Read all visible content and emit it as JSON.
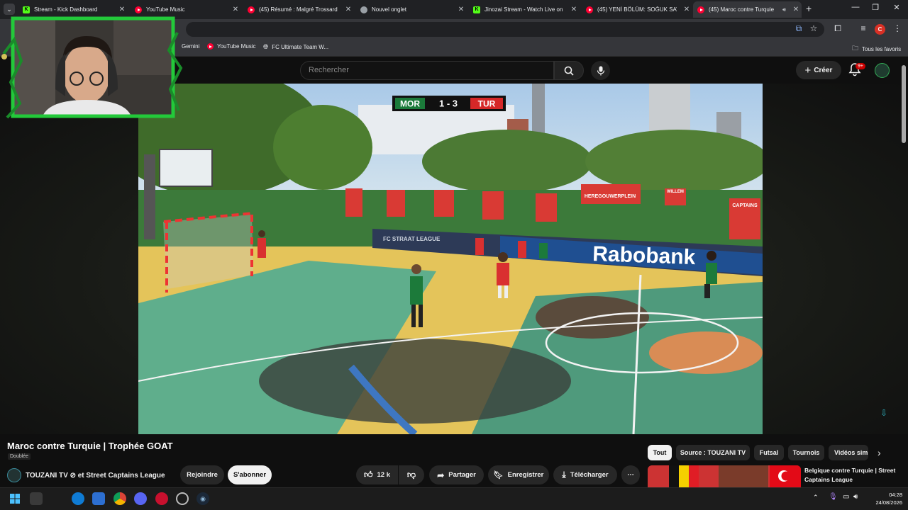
{
  "tabs": [
    {
      "title": "Stream - Kick Dashboard",
      "favicon": "kick-icon",
      "active": false
    },
    {
      "title": "YouTube Music",
      "favicon": "youtube-icon",
      "active": false
    },
    {
      "title": "(45) Résumé : Malgré Trossard",
      "favicon": "youtube-icon",
      "active": false
    },
    {
      "title": "Nouvel onglet",
      "favicon": "chrome-icon",
      "active": false
    },
    {
      "title": "Jinozai Stream - Watch Live on",
      "favicon": "kick-icon",
      "active": false
    },
    {
      "title": "(45) YENİ BÖLÜM: SOĞUK SAV",
      "favicon": "youtube-icon",
      "active": false
    },
    {
      "title": "(45) Maroc contre Turquie",
      "favicon": "youtube-icon",
      "active": true
    }
  ],
  "bookmarks": [
    {
      "label": "Gemini",
      "icon": "gemini-icon"
    },
    {
      "label": "YouTube Music",
      "icon": "youtube-music-icon"
    },
    {
      "label": "FC Ultimate Team W...",
      "icon": "globe-icon"
    }
  ],
  "all_bookmarks_label": "Tous les favoris",
  "profile_initial": "C",
  "youtube": {
    "search_placeholder": "Rechercher",
    "create_label": "Créer",
    "notif_badge": "9+"
  },
  "video": {
    "scoreboard": {
      "home": "MOR",
      "score": "1 - 3",
      "away": "TUR"
    },
    "banners": [
      "Rabobank",
      "FC STRAAT LEAGUE",
      "CAPTAINS",
      "HEREGOUWERPLEIN",
      "WILLEM"
    ],
    "title": "Maroc contre Turquie | Trophée GOAT",
    "dubbed_label": "Doublée",
    "channel_name": "TOUZANI TV ⊘ et Street Captains League",
    "join_label": "Rejoindre",
    "subscribe_label": "S'abonner",
    "likes": "12 k",
    "share_label": "Partager",
    "save_label": "Enregistrer",
    "download_label": "Télécharger"
  },
  "chips": [
    "Tout",
    "Source : TOUZANI TV",
    "Futsal",
    "Tournois",
    "Vidéos sim"
  ],
  "suggestion": {
    "title": "Belgique contre Turquie | Street Captains League"
  },
  "taskbar": {
    "time": "04:28",
    "date": "24/08/2026"
  },
  "colors": {
    "accent": "#ff0033",
    "kick": "#53fc18",
    "chip_selected": "#f1f1f1"
  }
}
